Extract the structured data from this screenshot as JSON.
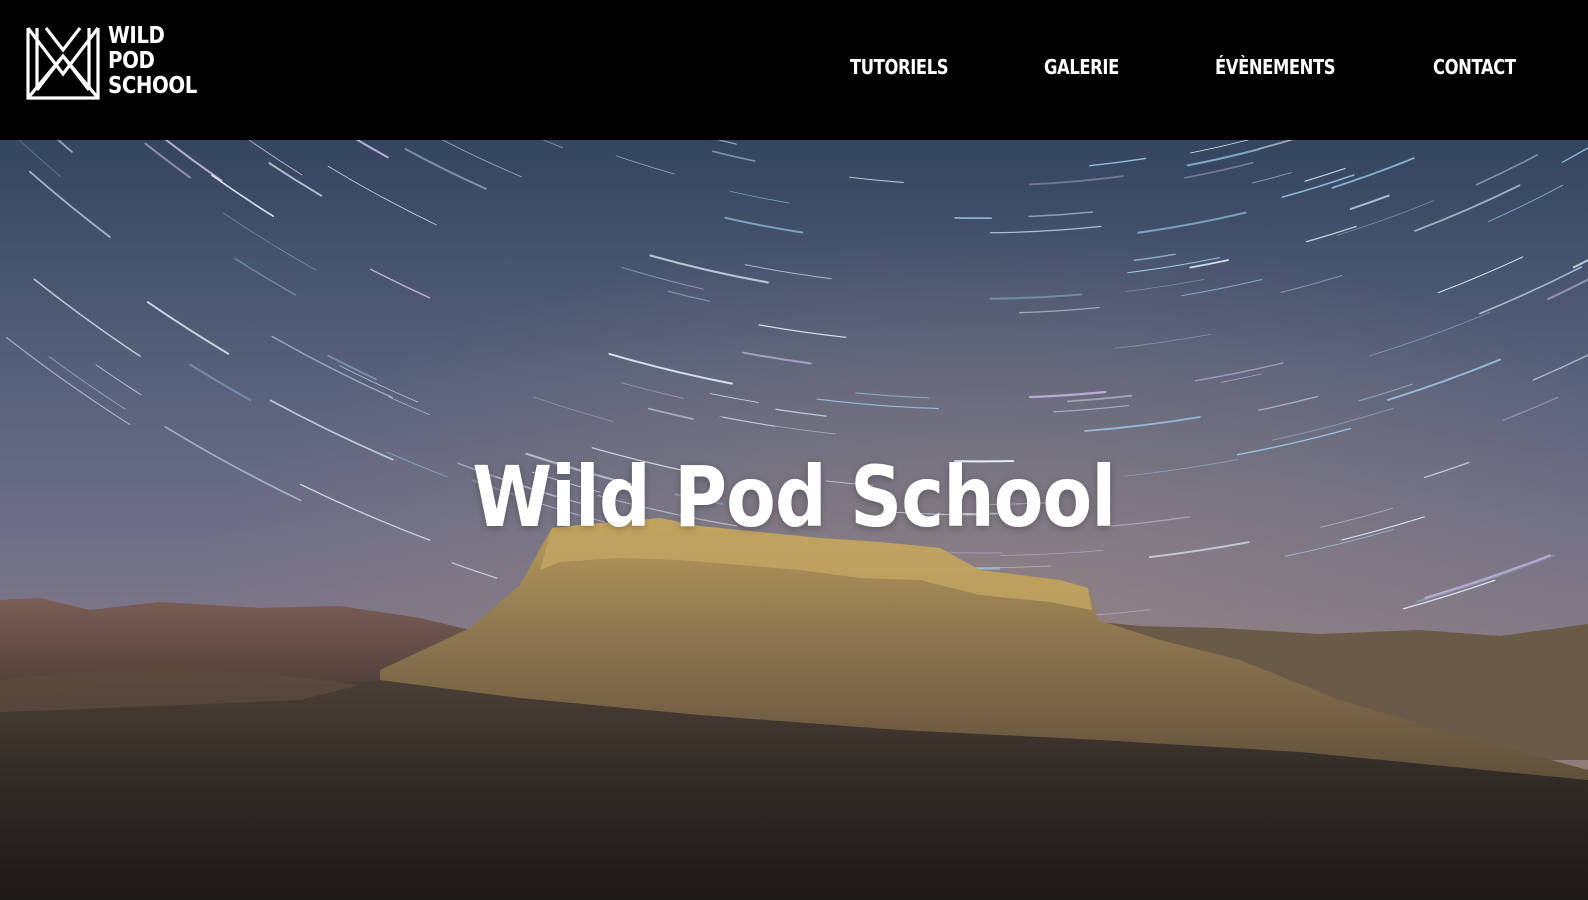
{
  "brand": {
    "logo_lines": [
      "WILD",
      "POD",
      "SCHOOL"
    ],
    "logo_icon": "wps-monogram-icon"
  },
  "nav": {
    "items": [
      {
        "label": "TUTORIELS"
      },
      {
        "label": "GALERIE"
      },
      {
        "label": "ÉVÈNEMENTS"
      },
      {
        "label": "CONTACT"
      }
    ]
  },
  "hero": {
    "title": "Wild Pod School"
  },
  "colors": {
    "header_bg": "#000000",
    "text": "#ffffff"
  }
}
